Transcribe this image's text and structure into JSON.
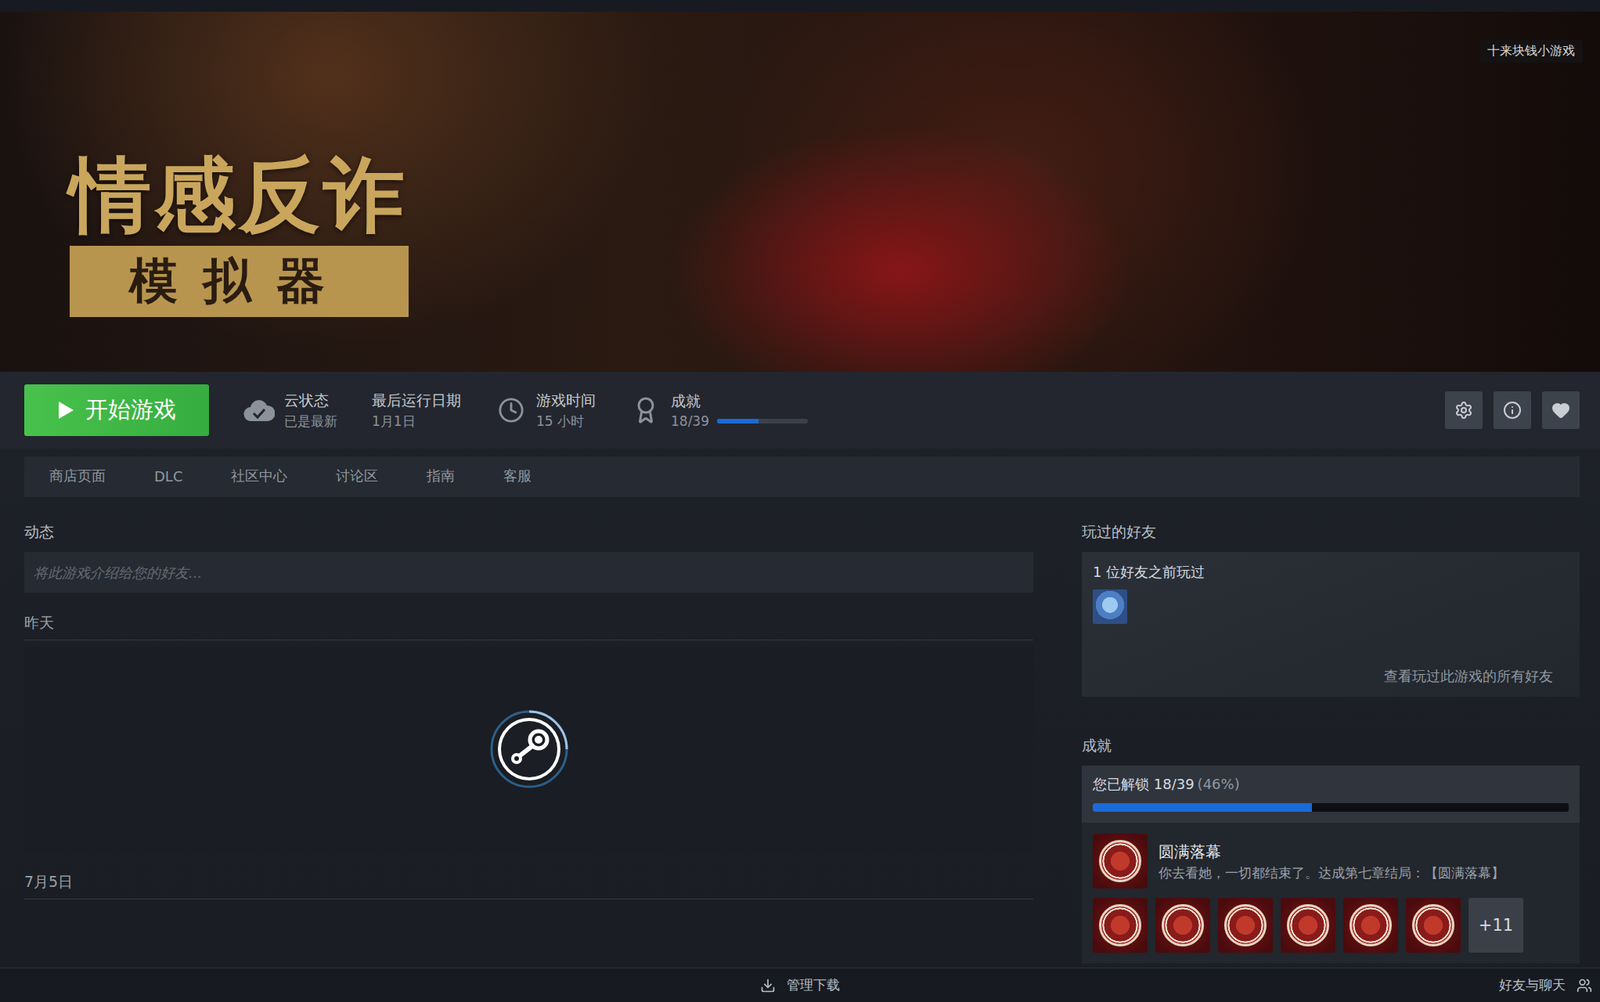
{
  "banner": {
    "logo_top": "情感反诈",
    "logo_bottom": "模拟器",
    "badge": "十来块钱小游戏"
  },
  "play_button": {
    "label": "开始游戏"
  },
  "stats": [
    {
      "label": "云状态",
      "value": "已是最新",
      "kind": "cloud"
    },
    {
      "label": "最后运行日期",
      "value": "1月1日",
      "kind": "plain"
    },
    {
      "label": "游戏时间",
      "value": "15 小时",
      "kind": "clock"
    },
    {
      "label": "成就",
      "value": "18/39",
      "kind": "progress",
      "level": 0.46
    }
  ],
  "tabs": [
    {
      "label": "商店页面",
      "selected": false
    },
    {
      "label": "DLC",
      "selected": false
    },
    {
      "label": "社区中心",
      "selected": false
    },
    {
      "label": "讨论区",
      "selected": false
    },
    {
      "label": "指南",
      "selected": false
    },
    {
      "label": "客服",
      "selected": false
    }
  ],
  "activity": {
    "title": "动态",
    "placeholder": "将此游戏介绍给您的好友...",
    "groups": [
      {
        "date": "昨天",
        "loading": true
      },
      {
        "date": "7月5日",
        "loading": false
      }
    ]
  },
  "friends": {
    "title": "玩过的好友",
    "count_text": "1 位好友之前玩过",
    "avatars": 1,
    "link": "查看玩过此游戏的所有好友"
  },
  "achievements": {
    "title": "成就",
    "summary": "您已解锁 18/39",
    "percent": "(46%)",
    "level": 0.46,
    "latest": {
      "name": "圆满落幕",
      "description": "你去看她，一切都结束了。达成第七章结局：【圆满落幕】"
    },
    "recent_icons": 6,
    "more": "+11"
  },
  "bottom_bar": {
    "downloads": "管理下载",
    "friends_chat": "好友与聊天"
  }
}
